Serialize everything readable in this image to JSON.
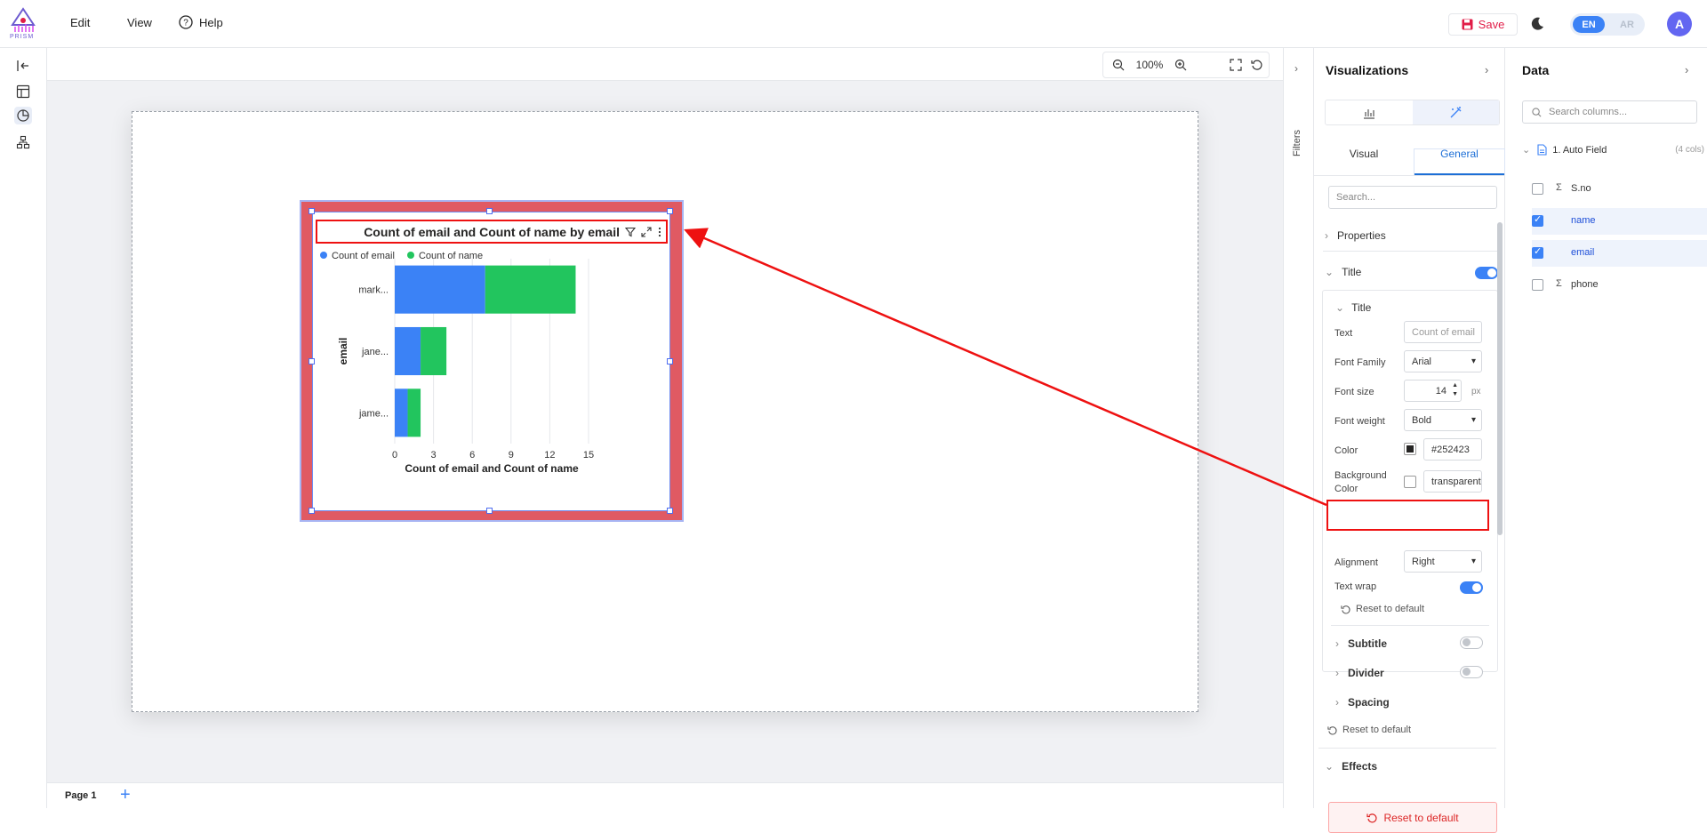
{
  "app": {
    "logo_text": "PRISM"
  },
  "menu": {
    "edit": "Edit",
    "view": "View",
    "help": "Help"
  },
  "header": {
    "save": "Save",
    "lang_en": "EN",
    "lang_ar": "AR",
    "avatar": "A"
  },
  "canvas": {
    "zoom": "100%",
    "page_tab": "Page 1",
    "add_page": "+"
  },
  "chart": {
    "title": "Count of email and Count of name by email",
    "legend": [
      "Count of email",
      "Count of name"
    ],
    "ylabel": "email",
    "xlabel": "Count of email and Count of name",
    "colors": {
      "email": "#3b82f6",
      "name": "#22c55e"
    }
  },
  "chart_data": {
    "type": "bar",
    "orientation": "horizontal",
    "stacked": true,
    "title": "Count of email and Count of name by email",
    "categories": [
      "mark...",
      "jane...",
      "jame..."
    ],
    "series": [
      {
        "name": "Count of email",
        "values": [
          7,
          2,
          1
        ]
      },
      {
        "name": "Count of name",
        "values": [
          7,
          2,
          1
        ]
      }
    ],
    "xlabel": "Count of email and Count of name",
    "ylabel": "email",
    "xlim": [
      0,
      15
    ],
    "xticks": [
      "0",
      "3",
      "6",
      "9",
      "12",
      "15"
    ],
    "grid": true,
    "legend_position": "top-left"
  },
  "filters": {
    "label": "Filters"
  },
  "visualizations": {
    "title": "Visualizations",
    "tabs": {
      "visual": "Visual",
      "general": "General"
    },
    "search_placeholder": "Search...",
    "properties": "Properties",
    "title_section": "Title",
    "title_sub": "Title",
    "fields": {
      "text_label": "Text",
      "text_value": "Count of email",
      "font_family_label": "Font Family",
      "font_family_value": "Arial",
      "font_size_label": "Font size",
      "font_size_value": "14",
      "font_size_unit": "px",
      "font_weight_label": "Font weight",
      "font_weight_value": "Bold",
      "color_label": "Color",
      "color_value": "#252423",
      "bg_label_1": "Background",
      "bg_label_2": "Color",
      "bg_value": "transparent",
      "alignment_label": "Alignment",
      "alignment_value": "Right",
      "text_wrap_label": "Text wrap",
      "reset_inner": "Reset to default"
    },
    "subtitle": "Subtitle",
    "divider": "Divider",
    "spacing": "Spacing",
    "reset_outer": "Reset to default",
    "effects": "Effects",
    "reset_bottom": "Reset to default"
  },
  "data_panel": {
    "title": "Data",
    "search_placeholder": "Search columns...",
    "table": {
      "name": "1. Auto Field",
      "cols": "(4 cols)"
    },
    "fields": [
      {
        "label": "S.no",
        "checked": false,
        "sigma": true
      },
      {
        "label": "name",
        "checked": true,
        "sigma": false
      },
      {
        "label": "email",
        "checked": true,
        "sigma": false
      },
      {
        "label": "phone",
        "checked": false,
        "sigma": true
      }
    ]
  }
}
